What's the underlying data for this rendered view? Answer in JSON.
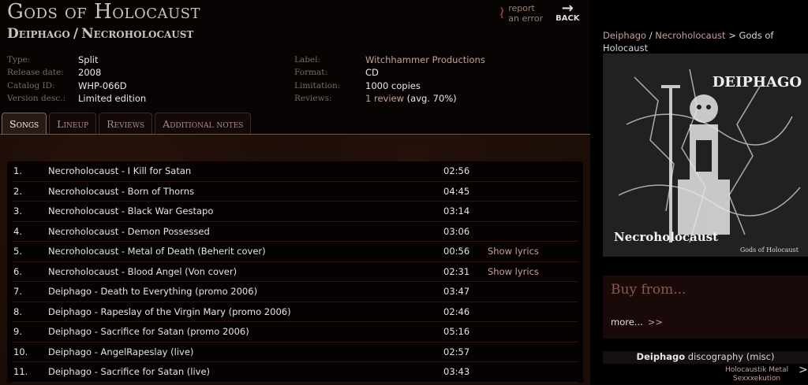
{
  "album": {
    "title": "Gods of Holocaust",
    "band1": "Deiphago",
    "band_sep": "/",
    "band2": "Necroholocaust"
  },
  "tools": {
    "report_line1": "report",
    "report_line2": "an error",
    "back": "BACK"
  },
  "details_left": [
    {
      "key": "Type:",
      "value": "Split"
    },
    {
      "key": "Release date:",
      "value": "2008"
    },
    {
      "key": "Catalog ID:",
      "value": "WHP-066D"
    },
    {
      "key": "Version desc.:",
      "value": "Limited edition"
    }
  ],
  "details_right": {
    "label_key": "Label:",
    "label_value": "Witchhammer Productions",
    "format_key": "Format:",
    "format_value": "CD",
    "limitation_key": "Limitation:",
    "limitation_value": "1000 copies",
    "reviews_key": "Reviews:",
    "reviews_link": "1 review",
    "reviews_avg": "(avg. 70%)"
  },
  "tabs": [
    {
      "label": "Songs",
      "active": true
    },
    {
      "label": "Lineup",
      "active": false
    },
    {
      "label": "Reviews",
      "active": false
    },
    {
      "label": "Additional notes",
      "active": false
    }
  ],
  "songs": [
    {
      "num": "1.",
      "title": "Necroholocaust - I Kill for Satan",
      "duration": "02:56",
      "lyrics": ""
    },
    {
      "num": "2.",
      "title": "Necroholocaust - Born of Thorns",
      "duration": "04:45",
      "lyrics": ""
    },
    {
      "num": "3.",
      "title": "Necroholocaust - Black War Gestapo",
      "duration": "03:14",
      "lyrics": ""
    },
    {
      "num": "4.",
      "title": "Necroholocaust - Demon Possessed",
      "duration": "03:06",
      "lyrics": ""
    },
    {
      "num": "5.",
      "title": "Necroholocaust - Metal of Death (Beherit cover)",
      "duration": "00:56",
      "lyrics": "Show lyrics"
    },
    {
      "num": "6.",
      "title": "Necroholocaust - Blood Angel (Von cover)",
      "duration": "02:31",
      "lyrics": "Show lyrics"
    },
    {
      "num": "7.",
      "title": "Deiphago - Death to Everything (promo 2006)",
      "duration": "03:47",
      "lyrics": ""
    },
    {
      "num": "8.",
      "title": "Deiphago - Rapeslay of the Virgin Mary (promo 2006)",
      "duration": "02:46",
      "lyrics": ""
    },
    {
      "num": "9.",
      "title": "Deiphago - Sacrifice for Satan (promo 2006)",
      "duration": "05:16",
      "lyrics": ""
    },
    {
      "num": "10.",
      "title": "Deiphago - AngelRapeslay (live)",
      "duration": "02:57",
      "lyrics": ""
    },
    {
      "num": "11.",
      "title": "Deiphago - Sacrifice for Satan (live)",
      "duration": "03:43",
      "lyrics": ""
    }
  ],
  "sidebar": {
    "crumb_band1": "Deiphago",
    "crumb_sep": "/",
    "crumb_band2": "Necroholocaust",
    "crumb_gt": ">",
    "crumb_album": "Gods of Holocaust",
    "cover_logo": "DEIPHAGO",
    "cover_band2": "Necroholocaust",
    "cover_caption": "Gods of Holocaust",
    "buy_title": "Buy from...",
    "buy_more": "more...",
    "buy_more_arrows": ">>",
    "disco_band": "Deiphago",
    "disco_label": "discography (misc)",
    "disco_item_line1": "Holocaustik Metal",
    "disco_item_line2": "Sexxxekution",
    "disco_next": ">"
  },
  "colors": {
    "link": "#c8a09a",
    "background": "#080403",
    "panel": "#1a0c07"
  }
}
